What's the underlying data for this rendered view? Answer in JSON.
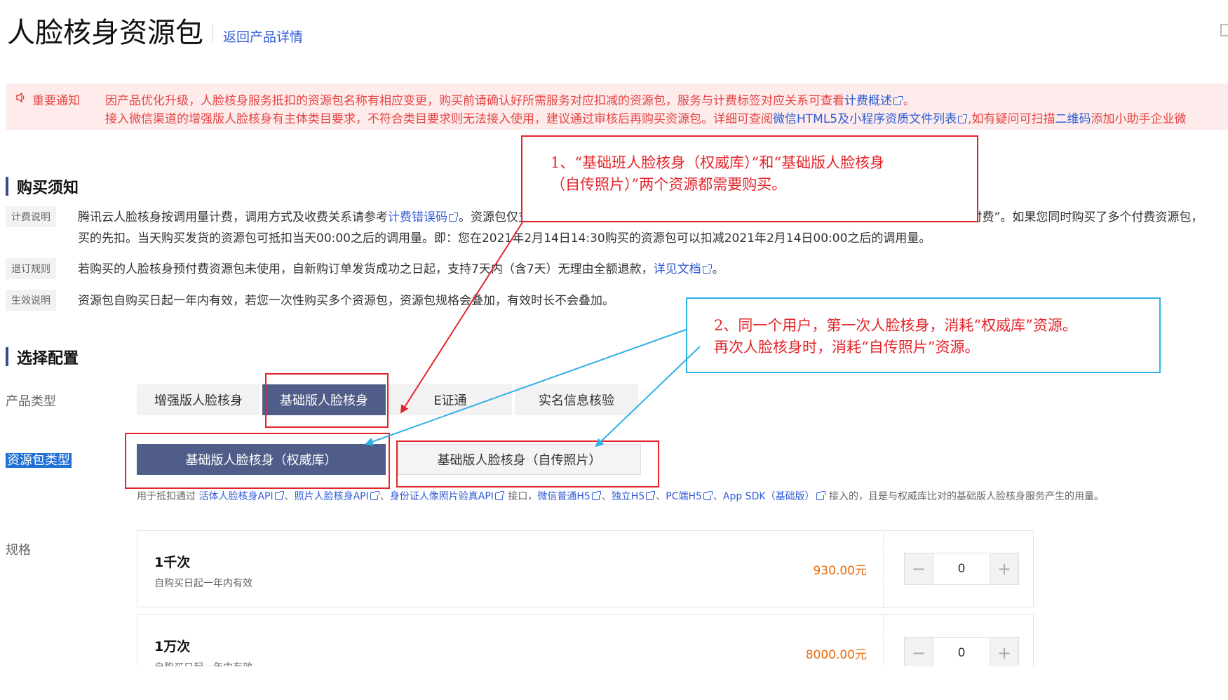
{
  "header": {
    "title": "人脸核身资源包",
    "back_link": "返回产品详情"
  },
  "notice": {
    "label": "重要通知",
    "line1_text": "因产品优化升级，人脸核身服务抵扣的资源包名称有相应变更，购买前请确认好所需服务对应扣减的资源包，服务与计费标签对应关系可查看",
    "line1_link": "计费概述",
    "line1_end": "。",
    "line2_text": "接入微信渠道的增强版人脸核身有主体类目要求，不符合类目要求则无法接入使用，建议通过审核后再购买资源包。详细可查阅",
    "line2_link": "微信HTML5及小程序资质文件列表",
    "line2_mid": ",如有疑问可扫描",
    "line2_link2": "二维码",
    "line2_end": "添加小助手企业微"
  },
  "purchase_notice": {
    "title": "购买须知",
    "billing": {
      "tag": "计费说明",
      "line1_a": "腾讯云人脸核身按调用量计费，调用方式及收费关系请参考",
      "line1_link": "计费错误码",
      "line1_b": "。资源包仅支持抵扣对应类型的接口调用量。调用量的扣费顺序为“免费资源包->付费资源包->后付费”。如果您同时购买了多个付费资源包，",
      "line2": "买的先扣。当天购买发货的资源包可抵扣当天00:00之后的调用量。即：您在2021年2月14日14:30购买的资源包可以扣减2021年2月14日00:00之后的调用量。"
    },
    "refund": {
      "tag": "退订规则",
      "text": "若购买的人脸核身预付费资源包未使用，自新购订单发货成功之日起，支持7天内（含7天）无理由全额退款，",
      "link": "详见文档",
      "end": "。"
    },
    "effective": {
      "tag": "生效说明",
      "text": "资源包自购买日起一年内有效，若您一次性购买多个资源包，资源包规格会叠加，有效时长不会叠加。"
    }
  },
  "config": {
    "title": "选择配置",
    "product_type_label": "产品类型",
    "product_types": [
      "增强版人脸核身",
      "基础版人脸核身",
      "E证通",
      "实名信息核验"
    ],
    "package_type_label": "资源包类型",
    "package_types": [
      "基础版人脸核身（权威库）",
      "基础版人脸核身（自传照片）"
    ],
    "package_desc": {
      "prefix": "用于抵扣通过",
      "links": [
        "活体人脸核身API",
        "照片人脸核身API",
        "身份证人像照片验真API"
      ],
      "mid": "接口，",
      "links2": [
        "微信普通H5",
        "独立H5",
        "PC端H5",
        "App SDK（基础版）"
      ],
      "suffix": "接入的，且是与权威库比对的基础版人脸核身服务产生的用量。",
      "sep": "、"
    },
    "spec_label": "规格",
    "specs": [
      {
        "name": "1千次",
        "sub": "自购买日起一年内有效",
        "price": "930.00元",
        "qty": "0"
      },
      {
        "name": "1万次",
        "sub": "自购买日起一年内有效",
        "price": "8000.00元",
        "qty": "0"
      }
    ],
    "minus": "−",
    "plus": "+"
  },
  "annotations": {
    "note1_line1": "1、“基础班人脸核身（权威库）”和“基础版人脸核身",
    "note1_line2": "（自传照片）”两个资源都需要购买。",
    "note2_line1": "2、同一个用户，第一次人脸核身，消耗“权威库”资源。",
    "note2_line2": "再次人脸核身时，消耗“自传照片”资源。"
  },
  "colors": {
    "accent": "#2f5bd6",
    "notice_red": "#e54545",
    "active_option": "#4f5d88",
    "price_orange": "#ed6a0c",
    "annot_red": "#e5242a",
    "annot_blue": "#2fb1e6"
  }
}
